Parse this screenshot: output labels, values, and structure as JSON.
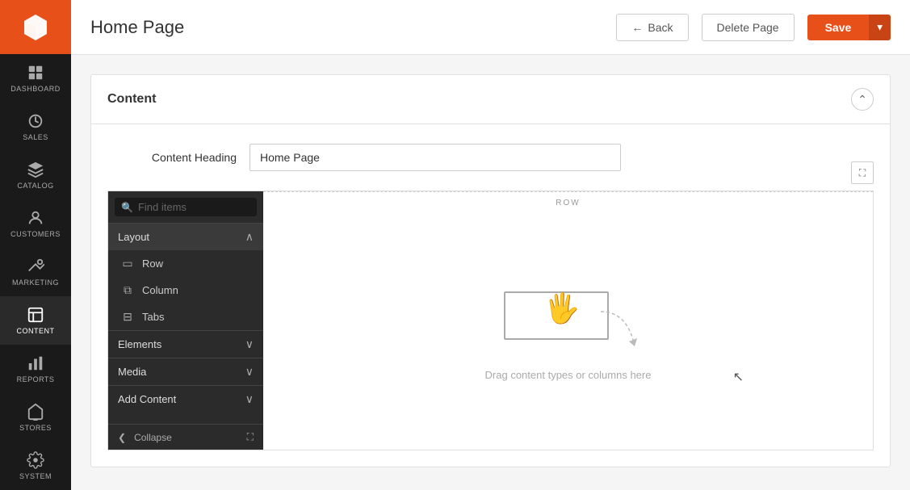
{
  "header": {
    "title": "Home Page",
    "back_label": "Back",
    "delete_label": "Delete Page",
    "save_label": "Save"
  },
  "sidebar": {
    "items": [
      {
        "id": "dashboard",
        "label": "DASHBOARD",
        "icon": "dashboard"
      },
      {
        "id": "sales",
        "label": "SALES",
        "icon": "sales"
      },
      {
        "id": "catalog",
        "label": "CATALOG",
        "icon": "catalog"
      },
      {
        "id": "customers",
        "label": "CUSTOMERS",
        "icon": "customers"
      },
      {
        "id": "marketing",
        "label": "MARKETING",
        "icon": "marketing"
      },
      {
        "id": "content",
        "label": "CONTENT",
        "icon": "content",
        "active": true
      },
      {
        "id": "reports",
        "label": "REPORTS",
        "icon": "reports"
      },
      {
        "id": "stores",
        "label": "STORES",
        "icon": "stores"
      },
      {
        "id": "system",
        "label": "SYSTEM",
        "icon": "system"
      }
    ]
  },
  "content_section": {
    "title": "Content",
    "heading_label": "Content Heading",
    "heading_value": "Home Page"
  },
  "panel": {
    "search_placeholder": "Find items",
    "layout_section": {
      "label": "Layout",
      "items": [
        {
          "id": "row",
          "label": "Row"
        },
        {
          "id": "column",
          "label": "Column"
        },
        {
          "id": "tabs",
          "label": "Tabs"
        }
      ]
    },
    "collapsed_sections": [
      {
        "id": "elements",
        "label": "Elements"
      },
      {
        "id": "media",
        "label": "Media"
      },
      {
        "id": "add-content",
        "label": "Add Content"
      }
    ],
    "collapse_label": "Collapse",
    "fullscreen_label": "Fullscreen"
  },
  "canvas": {
    "row_label": "ROW",
    "drop_text": "Drag content types or columns here"
  }
}
